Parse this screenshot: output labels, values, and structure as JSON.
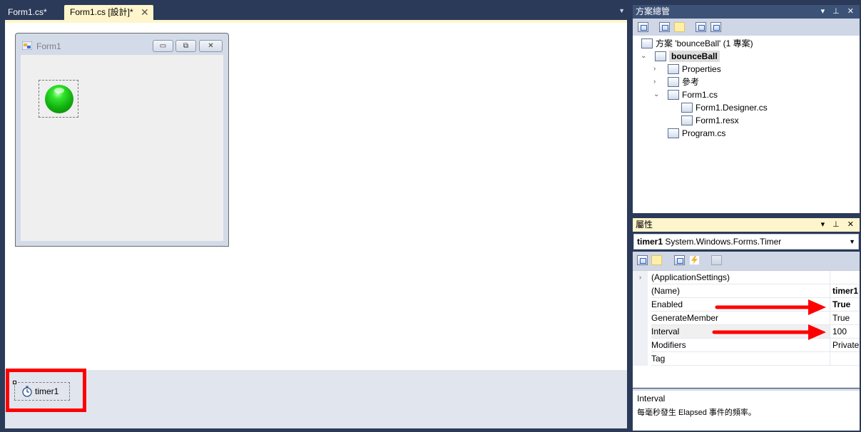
{
  "tabs": {
    "inactive_label": "Form1.cs*",
    "active_label": "Form1.cs [設計]*",
    "close_glyph": "✕",
    "menu_glyph": "▼"
  },
  "form": {
    "title": "Form1",
    "min_glyph": "▭",
    "max_glyph": "⧉",
    "close_glyph": "✕"
  },
  "tray": {
    "component_label": "timer1",
    "highlight_color": "#ff0000"
  },
  "solution_explorer": {
    "title": "方案總管",
    "pin_glyphs": "▾ ⊥ ✕",
    "tree": [
      {
        "label": "方案 'bounceBall' (1 專案)"
      },
      {
        "label": "bounceBall",
        "expanded_glyph": "⌄"
      },
      {
        "label": "Properties",
        "collapsed_glyph": "›"
      },
      {
        "label": "參考",
        "collapsed_glyph": "›"
      },
      {
        "label": "Form1.cs",
        "expanded_glyph": "⌄"
      },
      {
        "label": "Form1.Designer.cs"
      },
      {
        "label": "Form1.resx"
      },
      {
        "label": "Program.cs"
      }
    ]
  },
  "properties": {
    "title": "屬性",
    "pin_glyphs": "▾ ⊥ ✕",
    "object_name": "timer1",
    "object_type": "System.Windows.Forms.Timer",
    "dropdown_glyph": "▼",
    "rows": [
      {
        "name": "(ApplicationSettings)",
        "value": "",
        "glyph": "›"
      },
      {
        "name": "(Name)",
        "value": "timer1"
      },
      {
        "name": "Enabled",
        "value": "True"
      },
      {
        "name": "GenerateMember",
        "value": "True"
      },
      {
        "name": "Interval",
        "value": "100"
      },
      {
        "name": "Modifiers",
        "value": "Private"
      },
      {
        "name": "Tag",
        "value": ""
      }
    ],
    "description_title": "Interval",
    "description_text": "每毫秒發生 Elapsed 事件的頻率。",
    "annotation_color": "#ff0000"
  }
}
